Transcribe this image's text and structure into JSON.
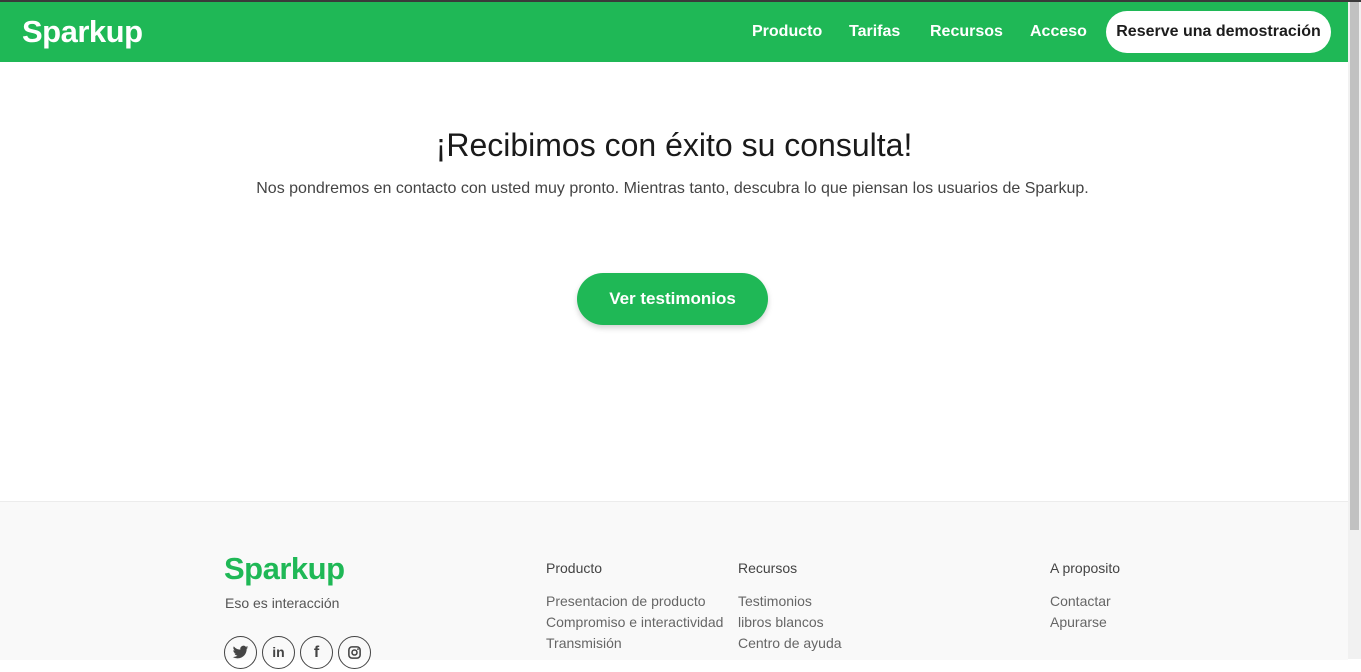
{
  "header": {
    "logo": "Sparkup",
    "nav": [
      "Producto",
      "Tarifas",
      "Recursos",
      "Acceso"
    ],
    "demo_label": "Reserve una demostración",
    "brand_color": "#1fb856"
  },
  "main": {
    "title": "¡Recibimos con éxito su consulta!",
    "subtitle": "Nos pondremos en contacto con usted muy pronto. Mientras tanto, descubra lo que piensan los usuarios de Sparkup.",
    "cta_label": "Ver testimonios"
  },
  "footer": {
    "logo": "Sparkup",
    "tagline": "Eso es interacción",
    "socials": [
      "twitter-icon",
      "linkedin-icon",
      "facebook-icon",
      "instagram-icon"
    ],
    "columns": [
      {
        "title": "Producto",
        "links": [
          "Presentacion de producto",
          "Compromiso e interactividad",
          "Transmisión"
        ]
      },
      {
        "title": "Recursos",
        "links": [
          "Testimonios",
          "libros blancos",
          "Centro de ayuda"
        ]
      },
      {
        "title": "A proposito",
        "links": [
          "Contactar",
          "Apurarse"
        ]
      }
    ]
  }
}
